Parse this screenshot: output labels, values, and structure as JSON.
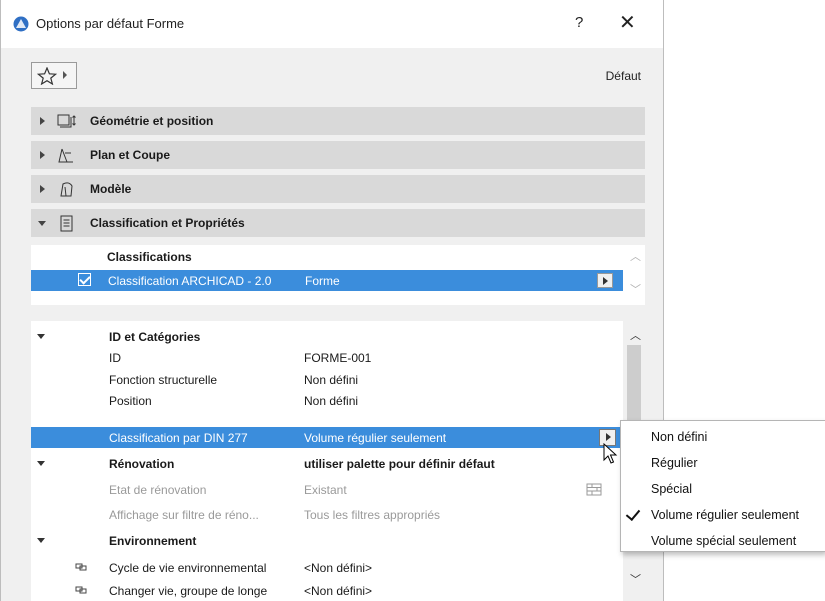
{
  "window": {
    "title": "Options par défaut Forme",
    "help": "?",
    "close": "✕"
  },
  "toolbar": {
    "favorites_icon": "star-icon",
    "default_label": "Défaut"
  },
  "panels": [
    {
      "label": "Géométrie et position",
      "icon": "geometry-icon",
      "expanded": false
    },
    {
      "label": "Plan et Coupe",
      "icon": "floorplan-icon",
      "expanded": false
    },
    {
      "label": "Modèle",
      "icon": "model-icon",
      "expanded": false
    },
    {
      "label": "Classification et Propriétés",
      "icon": "document-icon",
      "expanded": true
    }
  ],
  "classifications": {
    "header": "Classifications",
    "row": {
      "checked": true,
      "label": "Classification ARCHICAD - 2.0",
      "value": "Forme"
    }
  },
  "properties": [
    {
      "type": "group",
      "c1": "ID et Catégories",
      "c2": ""
    },
    {
      "type": "row",
      "c1": "ID",
      "c2": "FORME-001"
    },
    {
      "type": "row",
      "c1": "Fonction structurelle",
      "c2": "Non défini"
    },
    {
      "type": "row",
      "c1": "Position",
      "c2": "Non défini"
    },
    {
      "type": "selected",
      "c1": "Classification par DIN 277",
      "c2": "Volume régulier seulement"
    },
    {
      "type": "group",
      "c1": "Rénovation",
      "c2": "utiliser palette pour définir défaut"
    },
    {
      "type": "dim",
      "c1": "Etat de rénovation",
      "c2": "Existant"
    },
    {
      "type": "dim",
      "c1": "Affichage sur filtre de réno...",
      "c2": "Tous les filtres appropriés"
    },
    {
      "type": "group",
      "c1": "Environnement",
      "c2": ""
    },
    {
      "type": "link",
      "c1": "Cycle de vie environnemental",
      "c2": "<Non défini>"
    },
    {
      "type": "link",
      "c1": "Changer vie, groupe de longe",
      "c2": "<Non défini>"
    }
  ],
  "dropdown": {
    "items": [
      {
        "label": "Non défini",
        "checked": false
      },
      {
        "label": "Régulier",
        "checked": false
      },
      {
        "label": "Spécial",
        "checked": false
      },
      {
        "label": "Volume régulier seulement",
        "checked": true
      },
      {
        "label": "Volume spécial seulement",
        "checked": false
      }
    ]
  },
  "colors": {
    "selection": "#3b8ddc",
    "panel_header": "#d9d9d9",
    "dialog_bg": "#f0f0f0"
  }
}
